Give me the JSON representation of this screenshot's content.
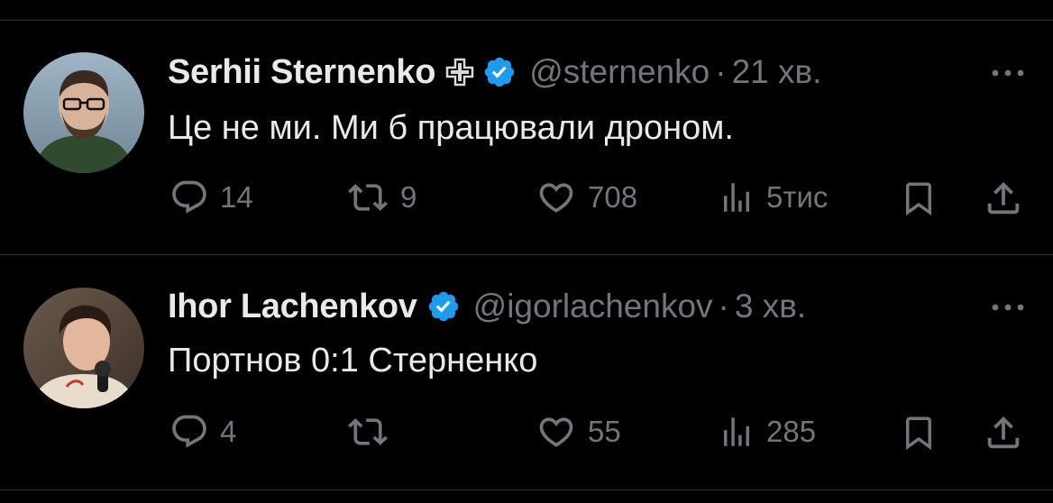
{
  "colors": {
    "background": "#000000",
    "text_primary": "#e7e9ea",
    "text_secondary": "#71767b",
    "verified_blue": "#1d9bf0",
    "divider": "#2f3336"
  },
  "tweets": [
    {
      "author": {
        "name": "Serhii Sternenko",
        "handle": "@sternenko",
        "affiliate_icon": "cross-plus-icon",
        "verified": true
      },
      "separator": "·",
      "time": "21 хв.",
      "text": "Це не ми. Ми б працювали дроном.",
      "actions": {
        "replies": "14",
        "reposts": "9",
        "likes": "708",
        "views": "5тис"
      }
    },
    {
      "author": {
        "name": "Ihor Lachenkov",
        "handle": "@igorlachenkov",
        "verified": true
      },
      "separator": "·",
      "time": "3 хв.",
      "text": "Портнов 0:1 Стерненко",
      "actions": {
        "replies": "4",
        "reposts": "",
        "likes": "55",
        "views": "285"
      }
    }
  ]
}
